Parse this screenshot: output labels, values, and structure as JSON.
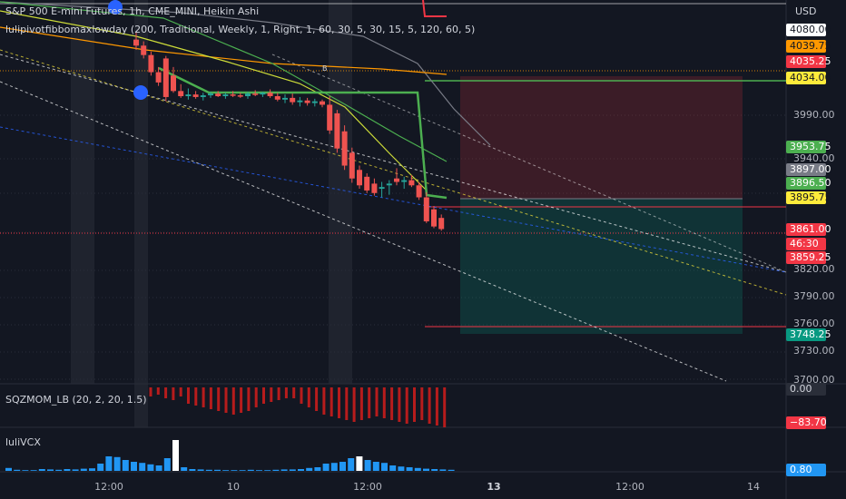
{
  "header": {
    "symbol_line": "S&P 500 E-mini Futures, 1h, CME_MINI, Heikin Ashi",
    "indicator_line": "lulipivotfibbomaxlowday (200, Traditional, Weekly, 1, Right, 1, 60, 30, 5, 30, 15, 5, 120, 60, 5)"
  },
  "price_axis": {
    "currency": "USD",
    "ticks": [
      "3990.00",
      "3940.00",
      "3820.00",
      "3790.00",
      "3760.00",
      "3730.00",
      "3700.00"
    ],
    "badges": [
      {
        "name": "badge-4080",
        "text": "4080.00",
        "bg": "#ffffff",
        "fg": "#131722"
      },
      {
        "name": "badge-4039",
        "text": "4039.75",
        "bg": "#ff9800",
        "fg": "#131722"
      },
      {
        "name": "badge-4035",
        "text": "4035.25",
        "bg": "#f23645",
        "fg": "#ffffff"
      },
      {
        "name": "badge-4034",
        "text": "4034.00",
        "bg": "#ffeb3b",
        "fg": "#131722"
      },
      {
        "name": "badge-3953",
        "text": "3953.75",
        "bg": "#4caf50",
        "fg": "#ffffff"
      },
      {
        "name": "badge-3897",
        "text": "3897.00",
        "bg": "#787b86",
        "fg": "#ffffff"
      },
      {
        "name": "badge-3896",
        "text": "3896.50",
        "bg": "#4caf50",
        "fg": "#ffffff"
      },
      {
        "name": "badge-3895",
        "text": "3895.75",
        "bg": "#ffeb3b",
        "fg": "#131722"
      },
      {
        "name": "badge-3861",
        "text": "3861.00",
        "bg": "#f23645",
        "fg": "#ffffff"
      },
      {
        "name": "badge-countdown",
        "text": "46:30",
        "bg": "#f23645",
        "fg": "#ffffff"
      },
      {
        "name": "badge-3859",
        "text": "3859.25",
        "bg": "#f23645",
        "fg": "#ffffff"
      },
      {
        "name": "badge-3748",
        "text": "3748.25",
        "bg": "#089981",
        "fg": "#ffffff"
      }
    ]
  },
  "time_axis": {
    "ticks": [
      {
        "label": "12:00",
        "bold": false
      },
      {
        "label": "10",
        "bold": false
      },
      {
        "label": "12:00",
        "bold": false
      },
      {
        "label": "13",
        "bold": true
      },
      {
        "label": "12:00",
        "bold": false
      },
      {
        "label": "14",
        "bold": false
      }
    ]
  },
  "panes": {
    "momentum": {
      "title": "SQZMOM_LB (20, 2, 20, 1.5)",
      "value_zero": "0.00",
      "value_last": "−83.70"
    },
    "vcx": {
      "title": "luliVCX",
      "value_last": "0.80"
    }
  },
  "markers": {
    "label_b": "B"
  },
  "chart_data": {
    "type": "candlestick",
    "description_series": "Heikin Ashi candles, 1h",
    "y_range": [
      3690,
      4095
    ],
    "candles": [
      {
        "o": 4082,
        "h": 4090,
        "l": 4070,
        "c": 4075
      },
      {
        "o": 4075,
        "h": 4080,
        "l": 4060,
        "c": 4064
      },
      {
        "o": 4064,
        "h": 4068,
        "l": 4040,
        "c": 4044
      },
      {
        "o": 4044,
        "h": 4050,
        "l": 4028,
        "c": 4032
      },
      {
        "o": 4060,
        "h": 4063,
        "l": 4010,
        "c": 4015
      },
      {
        "o": 4040,
        "h": 4050,
        "l": 4020,
        "c": 4022
      },
      {
        "o": 4022,
        "h": 4030,
        "l": 4014,
        "c": 4016
      },
      {
        "o": 4016,
        "h": 4025,
        "l": 4012,
        "c": 4018
      },
      {
        "o": 4018,
        "h": 4022,
        "l": 4013,
        "c": 4015
      },
      {
        "o": 4015,
        "h": 4020,
        "l": 4011,
        "c": 4017
      },
      {
        "o": 4017,
        "h": 4021,
        "l": 4014,
        "c": 4019
      },
      {
        "o": 4019,
        "h": 4022,
        "l": 4015,
        "c": 4016
      },
      {
        "o": 4016,
        "h": 4020,
        "l": 4013,
        "c": 4018
      },
      {
        "o": 4018,
        "h": 4022,
        "l": 4015,
        "c": 4017
      },
      {
        "o": 4017,
        "h": 4020,
        "l": 4014,
        "c": 4016
      },
      {
        "o": 4016,
        "h": 4021,
        "l": 4013,
        "c": 4019
      },
      {
        "o": 4019,
        "h": 4023,
        "l": 4016,
        "c": 4018
      },
      {
        "o": 4018,
        "h": 4021,
        "l": 4015,
        "c": 4020
      },
      {
        "o": 4020,
        "h": 4024,
        "l": 4014,
        "c": 4016
      },
      {
        "o": 4016,
        "h": 4020,
        "l": 4010,
        "c": 4012
      },
      {
        "o": 4012,
        "h": 4018,
        "l": 4008,
        "c": 4014
      },
      {
        "o": 4014,
        "h": 4019,
        "l": 4006,
        "c": 4009
      },
      {
        "o": 4009,
        "h": 4015,
        "l": 4004,
        "c": 4011
      },
      {
        "o": 4011,
        "h": 4014,
        "l": 4005,
        "c": 4008
      },
      {
        "o": 4008,
        "h": 4013,
        "l": 4004,
        "c": 4010
      },
      {
        "o": 4010,
        "h": 4012,
        "l": 4003,
        "c": 4006
      },
      {
        "o": 4006,
        "h": 4016,
        "l": 3972,
        "c": 3976
      },
      {
        "o": 3996,
        "h": 4000,
        "l": 3950,
        "c": 3955
      },
      {
        "o": 3975,
        "h": 3982,
        "l": 3930,
        "c": 3935
      },
      {
        "o": 3950,
        "h": 3956,
        "l": 3915,
        "c": 3920
      },
      {
        "o": 3930,
        "h": 3935,
        "l": 3908,
        "c": 3912
      },
      {
        "o": 3922,
        "h": 3926,
        "l": 3903,
        "c": 3906
      },
      {
        "o": 3914,
        "h": 3920,
        "l": 3900,
        "c": 3903
      },
      {
        "o": 3908,
        "h": 3916,
        "l": 3898,
        "c": 3910
      },
      {
        "o": 3912,
        "h": 3918,
        "l": 3901,
        "c": 3914
      },
      {
        "o": 3920,
        "h": 3932,
        "l": 3912,
        "c": 3916
      },
      {
        "o": 3916,
        "h": 3922,
        "l": 3908,
        "c": 3918
      },
      {
        "o": 3918,
        "h": 3924,
        "l": 3910,
        "c": 3912
      },
      {
        "o": 3912,
        "h": 3916,
        "l": 3895,
        "c": 3898
      },
      {
        "o": 3898,
        "h": 3904,
        "l": 3868,
        "c": 3870
      },
      {
        "o": 3884,
        "h": 3888,
        "l": 3862,
        "c": 3864
      },
      {
        "o": 3874,
        "h": 3878,
        "l": 3859,
        "c": 3861
      }
    ],
    "levels": [
      4080.0,
      4039.75,
      4035.25,
      4034.0,
      3953.75,
      3897.0,
      3896.5,
      3895.75,
      3861.0,
      3859.25,
      3748.25
    ],
    "position_tool": {
      "entry": 3895.75,
      "stop": 4040,
      "target": 3748.25
    },
    "momentum_last": -83.7,
    "momentum_zero": 0.0,
    "vcx_last": 0.8,
    "volume_bars": [
      0.08,
      0.03,
      0.02,
      0.02,
      0.05,
      0.04,
      0.03,
      0.05,
      0.04,
      0.06,
      0.07,
      0.2,
      0.4,
      0.38,
      0.3,
      0.25,
      0.22,
      0.18,
      0.15,
      0.35,
      0.85,
      0.1,
      0.05,
      0.04,
      0.03,
      0.03,
      0.02,
      0.02,
      0.02,
      0.03,
      0.02,
      0.02,
      0.03,
      0.04,
      0.04,
      0.05,
      0.08,
      0.1,
      0.2,
      0.22,
      0.25,
      0.35,
      0.4,
      0.3,
      0.25,
      0.22,
      0.15,
      0.12,
      0.1,
      0.08,
      0.06,
      0.05,
      0.04,
      0.03
    ]
  }
}
